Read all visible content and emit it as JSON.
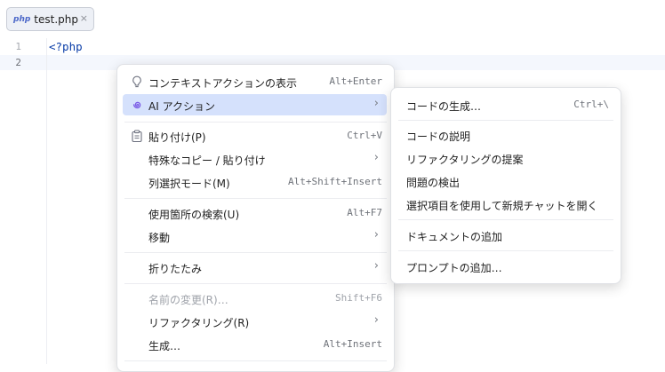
{
  "tab": {
    "badge": "php",
    "title": "test.php",
    "close": "×"
  },
  "editor": {
    "lines": [
      {
        "number": "1",
        "code": "<?php"
      },
      {
        "number": "2",
        "code": ""
      }
    ]
  },
  "context_menu": {
    "items": [
      {
        "label": "コンテキストアクションの表示",
        "shortcut": "Alt+Enter",
        "icon": "lightbulb-icon"
      },
      {
        "label": "AI アクション",
        "arrow": "›",
        "icon": "ai-spiral-icon",
        "selected": true
      },
      {
        "label": "貼り付け(P)",
        "shortcut": "Ctrl+V",
        "icon": "clipboard-icon"
      },
      {
        "label": "特殊なコピー / 貼り付け",
        "arrow": "›"
      },
      {
        "label": "列選択モード(M)",
        "shortcut": "Alt+Shift+Insert"
      },
      {
        "label": "使用箇所の検索(U)",
        "shortcut": "Alt+F7"
      },
      {
        "label": "移動",
        "arrow": "›"
      },
      {
        "label": "折りたたみ",
        "arrow": "›"
      },
      {
        "label": "名前の変更(R)…",
        "shortcut": "Shift+F6",
        "disabled": true
      },
      {
        "label": "リファクタリング(R)",
        "arrow": "›"
      },
      {
        "label": "生成…",
        "shortcut": "Alt+Insert"
      }
    ]
  },
  "ai_submenu": {
    "items": [
      {
        "label": "コードの生成…",
        "shortcut": "Ctrl+\\"
      },
      {
        "label": "コードの説明"
      },
      {
        "label": "リファクタリングの提案"
      },
      {
        "label": "問題の検出"
      },
      {
        "label": "選択項目を使用して新規チャットを開く"
      },
      {
        "label": "ドキュメントの追加"
      },
      {
        "label": "プロンプトの追加…"
      }
    ]
  },
  "colors": {
    "selection": "#d5e1fc",
    "php_badge": "#4a66c8",
    "ai_icon": "#7b5ce6"
  }
}
